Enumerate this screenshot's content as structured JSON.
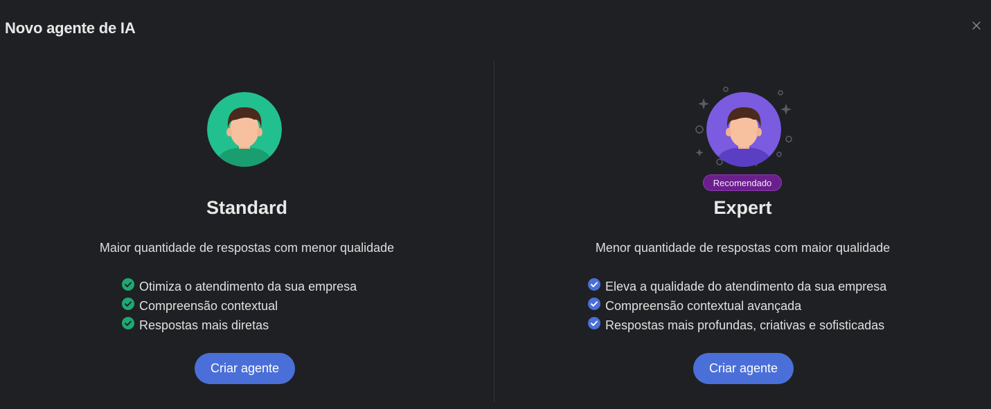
{
  "dialog": {
    "title": "Novo agente de IA",
    "close_icon": "close-icon"
  },
  "plans": [
    {
      "name": "Standard",
      "description": "Maior quantidade de respostas com menor qualidade",
      "features": [
        "Otimiza o atendimento da sua empresa",
        "Compreensão contextual",
        "Respostas mais diretas"
      ],
      "button_label": "Criar agente",
      "accent_color": "#22c08e",
      "check_color": "#1ea874",
      "avatar_icon": "person-avatar-icon"
    },
    {
      "name": "Expert",
      "badge": "Recomendado",
      "description": "Menor quantidade de respostas com maior qualidade",
      "features": [
        "Eleva a qualidade do atendimento da sua empresa",
        "Compreensão contextual avançada",
        "Respostas mais profundas, criativas e sofisticadas"
      ],
      "button_label": "Criar agente",
      "accent_color": "#7b5be0",
      "check_color": "#4a6fd8",
      "avatar_icon": "person-avatar-icon"
    }
  ],
  "colors": {
    "background": "#1f2023",
    "button": "#4a6fd8",
    "badge": "#6b1f8c"
  }
}
